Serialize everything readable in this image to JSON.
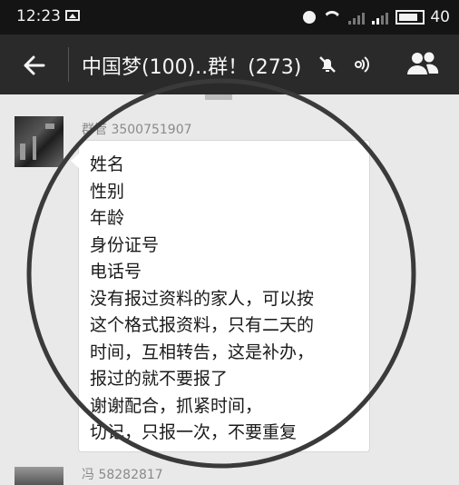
{
  "status_bar": {
    "time": "12:23",
    "battery_level": "40",
    "icons": [
      "photo-icon",
      "alarm-icon",
      "wifi-icon",
      "signal-icon",
      "battery-icon"
    ]
  },
  "title_bar": {
    "chat_title": "中国梦(100)..群！(273)",
    "icons": [
      "back-arrow-icon",
      "mute-icon",
      "voice-icon",
      "members-icon"
    ]
  },
  "messages": [
    {
      "sender": "群管 3500751907",
      "lines": [
        "姓名",
        "性别",
        "年龄",
        "身份证号",
        "电话号",
        "没有报过资料的家人，可以按",
        "这个格式报资料，只有二天的",
        "时间，互相转告，这是补办，",
        "报过的就不要报了",
        "谢谢配合，抓紧时间，",
        "切记，只报一次，不要重复"
      ]
    },
    {
      "sender": "冯        58282817"
    }
  ],
  "colors": {
    "status_bar_bg": "#141414",
    "title_bar_bg": "#2a2a2a",
    "chat_bg": "#e9e9e9",
    "bubble_bg": "#ffffff"
  }
}
